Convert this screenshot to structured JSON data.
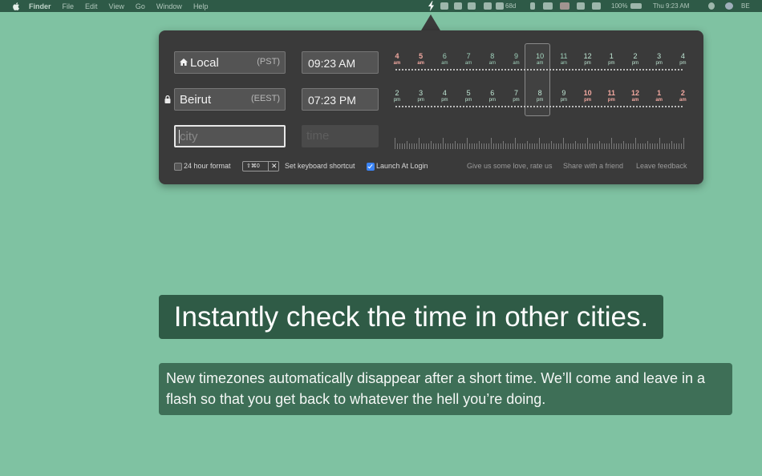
{
  "menubar": {
    "app_name": "Finder",
    "menus": [
      "File",
      "Edit",
      "View",
      "Go",
      "Window",
      "Help"
    ],
    "status": {
      "days_label": "68d",
      "battery": "100%",
      "clock": "Thu 9:23 AM",
      "input_source": "BE"
    }
  },
  "rows": [
    {
      "city": "Local",
      "abbr": "(PST)",
      "time": "09:23 AM",
      "home": true,
      "locked": false
    },
    {
      "city": "Beirut",
      "abbr": "(EEST)",
      "time": "07:23 PM",
      "home": false,
      "locked": true
    }
  ],
  "new_row": {
    "city_placeholder": "city",
    "time_placeholder": "time"
  },
  "timeline": {
    "local_hours": [
      {
        "h": "4",
        "ap": "am"
      },
      {
        "h": "5",
        "ap": "am"
      },
      {
        "h": "6",
        "ap": "am"
      },
      {
        "h": "7",
        "ap": "am"
      },
      {
        "h": "8",
        "ap": "am"
      },
      {
        "h": "9",
        "ap": "am"
      },
      {
        "h": "10",
        "ap": "am"
      },
      {
        "h": "11",
        "ap": "am"
      },
      {
        "h": "12",
        "ap": "pm"
      },
      {
        "h": "1",
        "ap": "pm"
      },
      {
        "h": "2",
        "ap": "pm"
      },
      {
        "h": "3",
        "ap": "pm"
      },
      {
        "h": "4",
        "ap": "pm"
      }
    ],
    "beirut_hours": [
      {
        "h": "2",
        "ap": "pm"
      },
      {
        "h": "3",
        "ap": "pm"
      },
      {
        "h": "4",
        "ap": "pm"
      },
      {
        "h": "5",
        "ap": "pm"
      },
      {
        "h": "6",
        "ap": "pm"
      },
      {
        "h": "7",
        "ap": "pm"
      },
      {
        "h": "8",
        "ap": "pm"
      },
      {
        "h": "9",
        "ap": "pm"
      },
      {
        "h": "10",
        "ap": "pm"
      },
      {
        "h": "11",
        "ap": "pm"
      },
      {
        "h": "12",
        "ap": "am"
      },
      {
        "h": "1",
        "ap": "am"
      },
      {
        "h": "2",
        "ap": "am"
      }
    ],
    "selected_index": 6
  },
  "footer": {
    "format_24h_label": "24 hour format",
    "format_24h_checked": false,
    "shortcut_keys": "⇧⌘0",
    "shortcut_clear": "✕",
    "set_shortcut_label": "Set keyboard shortcut",
    "launch_at_login_label": "Launch At Login",
    "launch_at_login_checked": true,
    "rate_link": "Give us some love, rate us",
    "share_link": "Share with a friend",
    "feedback_link": "Leave feedback"
  },
  "caption": {
    "headline": "Instantly check the time in other cities.",
    "body": "New timezones automatically disappear after a short time. We’ll come and leave in a flash so that you get back to whatever the hell you’re doing."
  },
  "colors": {
    "background": "#7fc2a2",
    "headline_bg": "#2f5b46",
    "body_bg": "#3e6f57",
    "popover_bg": "#3a3a3a",
    "night_hour": "#f2a8a0",
    "day_hour": "#9fd1bb",
    "checkbox_on": "#3b84f5"
  }
}
